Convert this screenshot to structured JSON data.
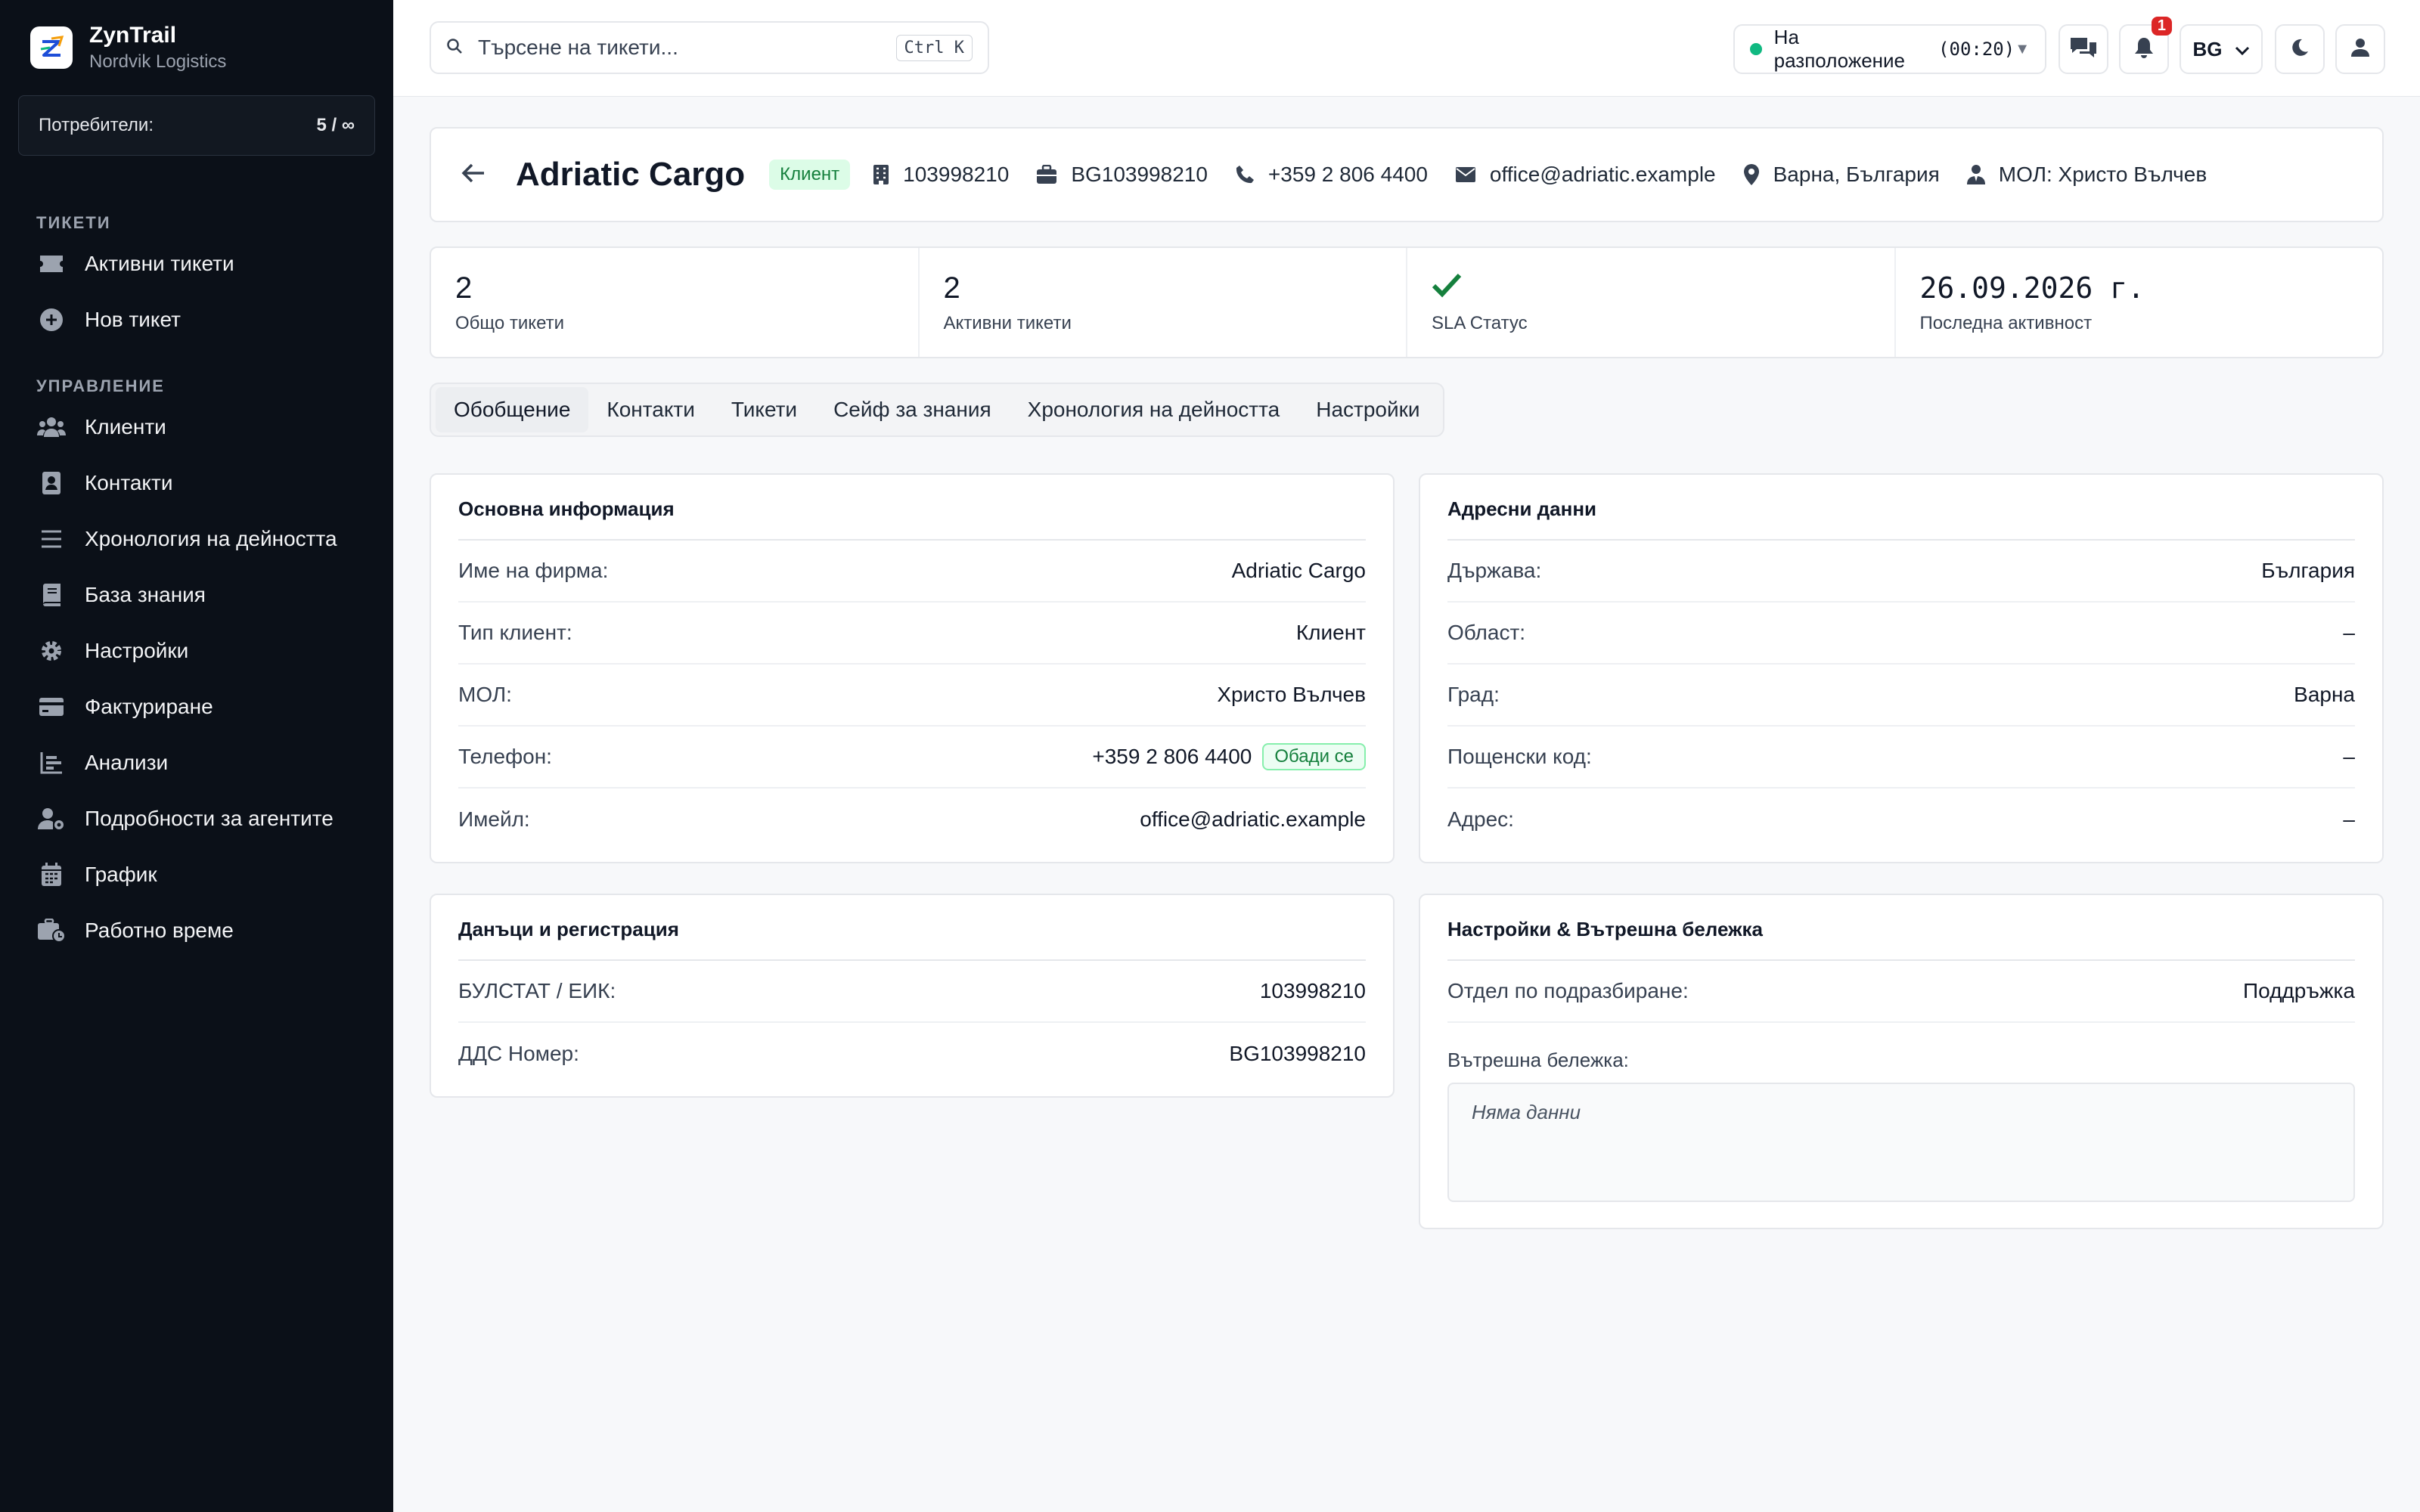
{
  "brand": {
    "name": "ZynTrail",
    "org": "Nordvik Logistics"
  },
  "users": {
    "label": "Потребители:",
    "value": "5 / ∞"
  },
  "nav": {
    "section_tickets": "ТИКЕТИ",
    "active_tickets": "Активни тикети",
    "new_ticket": "Нов тикет",
    "section_manage": "УПРАВЛЕНИЕ",
    "clients": "Клиенти",
    "contacts": "Контакти",
    "activity": "Хронология на дейността",
    "knowledge": "База знания",
    "settings": "Настройки",
    "billing": "Фактуриране",
    "analytics": "Анализи",
    "agents": "Подробности за агентите",
    "schedule": "График",
    "worktime": "Работно време"
  },
  "topbar": {
    "search_placeholder": "Търсене на тикети...",
    "search_shortcut": "Ctrl K",
    "status_label": "На разположение",
    "status_time": "(00:20)",
    "notifications_count": "1",
    "language": "BG"
  },
  "client": {
    "name": "Adriatic Cargo",
    "type": "Клиент",
    "eik": "103998210",
    "vat": "BG103998210",
    "phone": "+359 2 806 4400",
    "email": "office@adriatic.example",
    "location": "Варна, България",
    "mol": "МОЛ: Христо Вълчев"
  },
  "stats": {
    "total_value": "2",
    "total_label": "Общо тикети",
    "active_value": "2",
    "active_label": "Активни тикети",
    "sla_label": "SLA Статус",
    "last_value": "26.09.2026 г.",
    "last_label": "Последна активност"
  },
  "tabs": [
    "Обобщение",
    "Контакти",
    "Тикети",
    "Сейф за знания",
    "Хронология на дейността",
    "Настройки"
  ],
  "basic": {
    "title": "Основна информация",
    "rows": [
      {
        "k": "Име на фирма:",
        "v": "Adriatic Cargo"
      },
      {
        "k": "Тип клиент:",
        "v": "Клиент"
      },
      {
        "k": "МОЛ:",
        "v": "Христо Вълчев"
      },
      {
        "k": "Телефон:",
        "v": "+359 2 806 4400"
      },
      {
        "k": "Имейл:",
        "v": "office@adriatic.example"
      }
    ],
    "call_label": "Обади се"
  },
  "address": {
    "title": "Адресни данни",
    "rows": [
      {
        "k": "Държава:",
        "v": "България"
      },
      {
        "k": "Област:",
        "v": "–"
      },
      {
        "k": "Град:",
        "v": "Варна"
      },
      {
        "k": "Пощенски код:",
        "v": "–"
      },
      {
        "k": "Адрес:",
        "v": "–"
      }
    ]
  },
  "tax": {
    "title": "Данъци и регистрация",
    "rows": [
      {
        "k": "БУЛСТАТ / ЕИК:",
        "v": "103998210"
      },
      {
        "k": "ДДС Номер:",
        "v": "BG103998210"
      }
    ]
  },
  "internal": {
    "title": "Настройки & Вътрешна бележка",
    "dept_label": "Отдел по подразбиране:",
    "dept_value": "Поддръжка",
    "note_label": "Вътрешна бележка:",
    "note_value": "Няма данни"
  },
  "colors": {
    "sidebar_bg": "#0b1018",
    "accent_green": "#15803d",
    "badge_red": "#dc2626"
  }
}
